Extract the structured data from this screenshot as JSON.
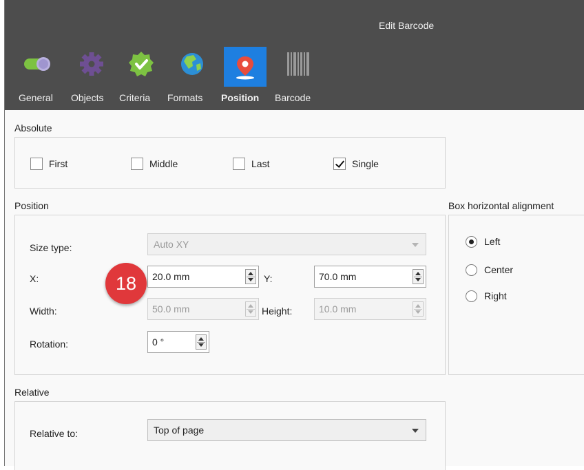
{
  "window": {
    "title": "Edit Barcode"
  },
  "tabs": [
    {
      "label": "General",
      "icon": "toggle-switch-icon"
    },
    {
      "label": "Objects",
      "icon": "gear-icon"
    },
    {
      "label": "Criteria",
      "icon": "check-badge-icon"
    },
    {
      "label": "Formats",
      "icon": "globe-icon"
    },
    {
      "label": "Position",
      "icon": "location-pin-icon",
      "active": true
    },
    {
      "label": "Barcode",
      "icon": "barcode-icon"
    }
  ],
  "absolute": {
    "title": "Absolute",
    "options": [
      {
        "label": "First",
        "checked": false
      },
      {
        "label": "Middle",
        "checked": false
      },
      {
        "label": "Last",
        "checked": false
      },
      {
        "label": "Single",
        "checked": true
      }
    ]
  },
  "position": {
    "title": "Position",
    "size_type_label": "Size type:",
    "size_type_value": "Auto XY",
    "x_label": "X:",
    "x_value": "20.0 mm",
    "y_label": "Y:",
    "y_value": "70.0 mm",
    "width_label": "Width:",
    "width_value": "50.0 mm",
    "height_label": "Height:",
    "height_value": "10.0 mm",
    "rotation_label": "Rotation:",
    "rotation_value": "0 °"
  },
  "alignment": {
    "title": "Box horizontal alignment",
    "options": [
      {
        "label": "Left",
        "selected": true
      },
      {
        "label": "Center",
        "selected": false
      },
      {
        "label": "Right",
        "selected": false
      }
    ]
  },
  "relative": {
    "title": "Relative",
    "relative_to_label": "Relative to:",
    "relative_to_value": "Top of page"
  },
  "annotation": {
    "number": "18"
  },
  "colors": {
    "titlebar": "#4d4d4d",
    "active_tab": "#1e7fe0",
    "badge": "#e0383b"
  }
}
